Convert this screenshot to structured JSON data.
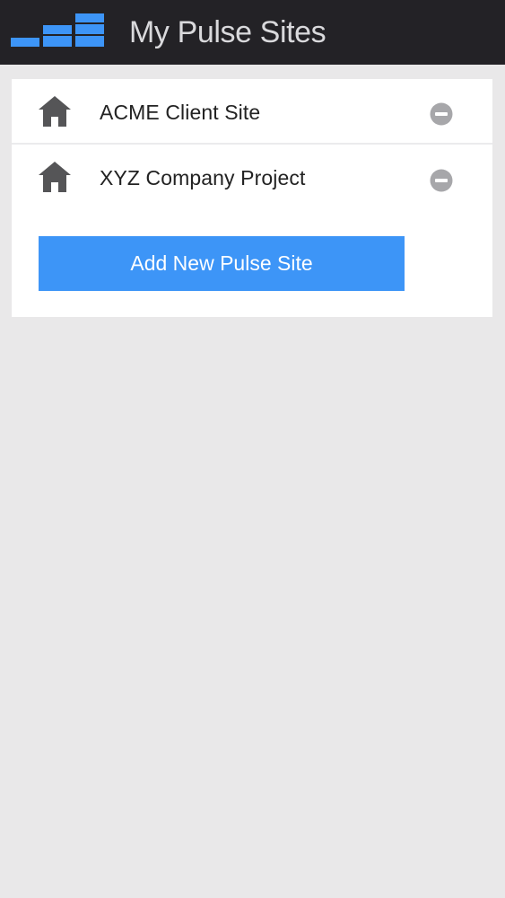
{
  "header": {
    "title": "My Pulse Sites",
    "logo_icon": "pulse-bars-logo",
    "background_color": "#232226",
    "logo_color": "#3d95f7"
  },
  "sites": [
    {
      "label": "ACME Client Site",
      "icon": "home-icon",
      "action_icon": "remove-icon"
    },
    {
      "label": "XYZ Company Project",
      "icon": "home-icon",
      "action_icon": "remove-icon"
    }
  ],
  "add_button": {
    "label": "Add New Pulse Site",
    "color": "#3d95f7"
  }
}
